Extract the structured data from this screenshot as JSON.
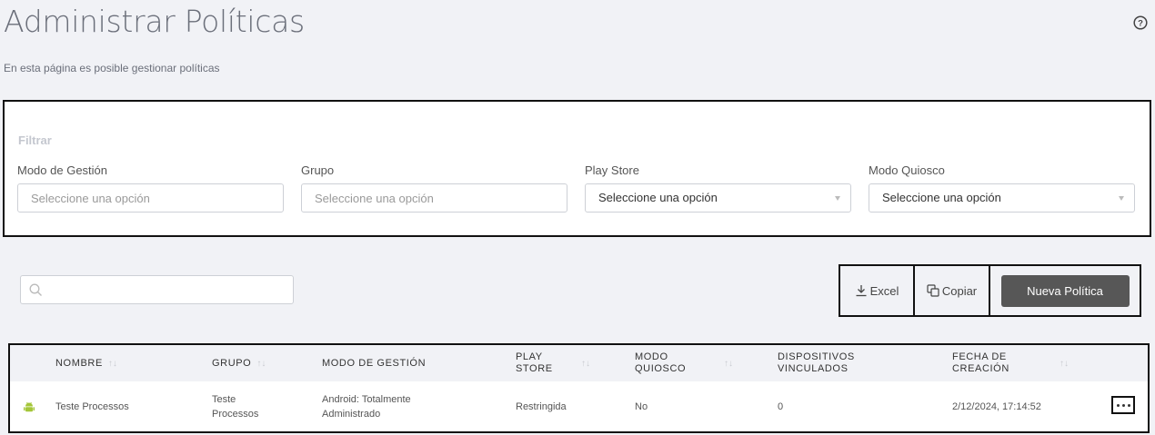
{
  "header": {
    "title": "Administrar Políticas",
    "subtitle": "En esta página es posible gestionar políticas"
  },
  "filter": {
    "title": "Filtrar",
    "fields": [
      {
        "label": "Modo de Gestión",
        "placeholder": "Seleccione una opción",
        "type": "input"
      },
      {
        "label": "Grupo",
        "placeholder": "Seleccione una opción",
        "type": "input"
      },
      {
        "label": "Play Store",
        "value": "Seleccione una opción",
        "type": "select"
      },
      {
        "label": "Modo Quiosco",
        "value": "Seleccione una opción",
        "type": "select"
      }
    ]
  },
  "search": {
    "placeholder": ""
  },
  "toolbar": {
    "excel_label": "Excel",
    "copy_label": "Copiar",
    "new_label": "Nueva Política"
  },
  "table": {
    "columns": [
      {
        "label": "NOMBRE",
        "sortable": true
      },
      {
        "label": "GRUPO",
        "sortable": true
      },
      {
        "label": "MODO DE GESTIÓN",
        "sortable": false
      },
      {
        "label": "PLAY STORE",
        "sortable": true
      },
      {
        "label": "MODO QUIOSCO",
        "sortable": true
      },
      {
        "label": "DISPOSITIVOS VINCULADOS",
        "sortable": false
      },
      {
        "label": "FECHA DE CREACIÓN",
        "sortable": true
      }
    ],
    "sort_glyph": "↑↓",
    "rows": [
      {
        "icon": "android-icon",
        "nombre": "Teste Processos",
        "grupo": "Teste Processos",
        "modo_gestion": "Android: Totalmente Administrado",
        "play_store": "Restringida",
        "modo_quiosco": "No",
        "dispositivos": "0",
        "fecha": "2/12/2024, 17:14:52"
      }
    ]
  },
  "colors": {
    "background": "#f1f2f6",
    "primary_button": "#575757",
    "android_green": "#a4c639"
  }
}
